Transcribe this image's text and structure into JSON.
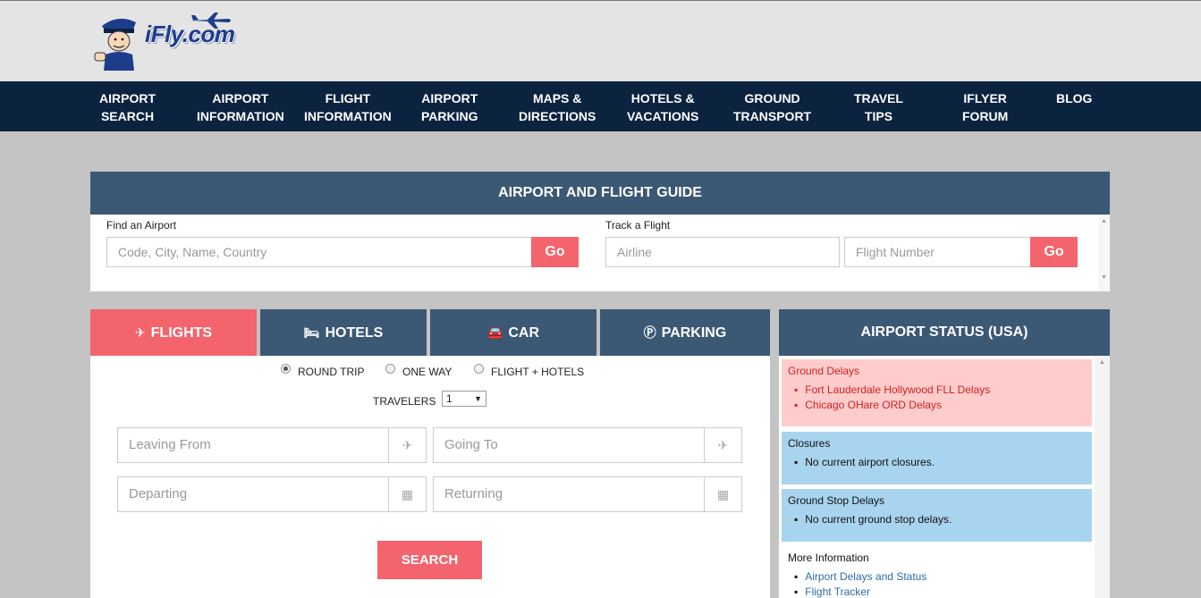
{
  "logo": {
    "text": "iFly.com"
  },
  "nav": [
    {
      "label": "AIRPORT\nSEARCH"
    },
    {
      "label": "AIRPORT\nINFORMATION"
    },
    {
      "label": "FLIGHT\nINFORMATION"
    },
    {
      "label": "AIRPORT\nPARKING"
    },
    {
      "label": "MAPS &\nDIRECTIONS"
    },
    {
      "label": "HOTELS &\nVACATIONS"
    },
    {
      "label": "GROUND\nTRANSPORT"
    },
    {
      "label": "TRAVEL\nTIPS"
    },
    {
      "label": "IFLYER\nFORUM"
    },
    {
      "label": "BLOG"
    }
  ],
  "guide": {
    "title": "AIRPORT AND FLIGHT GUIDE",
    "find_label": "Find an Airport",
    "find_placeholder": "Code, City, Name, Country",
    "find_go": "Go",
    "track_label": "Track a Flight",
    "airline_placeholder": "Airline",
    "flight_placeholder": "Flight Number",
    "track_go": "Go"
  },
  "tabs": [
    {
      "label": "FLIGHTS",
      "icon": "plane-icon",
      "active": true
    },
    {
      "label": "HOTELS",
      "icon": "bed-icon",
      "active": false
    },
    {
      "label": "CAR",
      "icon": "car-icon",
      "active": false
    },
    {
      "label": "PARKING",
      "icon": "parking-icon",
      "active": false
    }
  ],
  "search": {
    "trip_types": [
      {
        "label": "ROUND TRIP",
        "selected": true
      },
      {
        "label": "ONE WAY",
        "selected": false
      },
      {
        "label": "FLIGHT + HOTELS",
        "selected": false
      }
    ],
    "travelers_label": "TRAVELERS",
    "travelers_value": "1",
    "leaving_placeholder": "Leaving From",
    "going_placeholder": "Going To",
    "departing_placeholder": "Departing",
    "returning_placeholder": "Returning",
    "search_button": "SEARCH"
  },
  "status": {
    "title": "AIRPORT STATUS (USA)",
    "ground_delays": {
      "title": "Ground Delays",
      "items": [
        "Fort Lauderdale Hollywood FLL Delays",
        "Chicago OHare ORD Delays"
      ]
    },
    "closures": {
      "title": "Closures",
      "items": [
        "No current airport closures."
      ]
    },
    "ground_stop": {
      "title": "Ground Stop Delays",
      "items": [
        "No current ground stop delays."
      ]
    },
    "more_info": {
      "title": "More Information",
      "items": [
        "Airport Delays and Status",
        "Flight Tracker"
      ]
    }
  },
  "colors": {
    "nav_bg": "#0c2340",
    "panel_header": "#3b5874",
    "accent": "#f4646d",
    "delay_bg": "#ffcccc",
    "info_bg": "#a8d4ef"
  }
}
